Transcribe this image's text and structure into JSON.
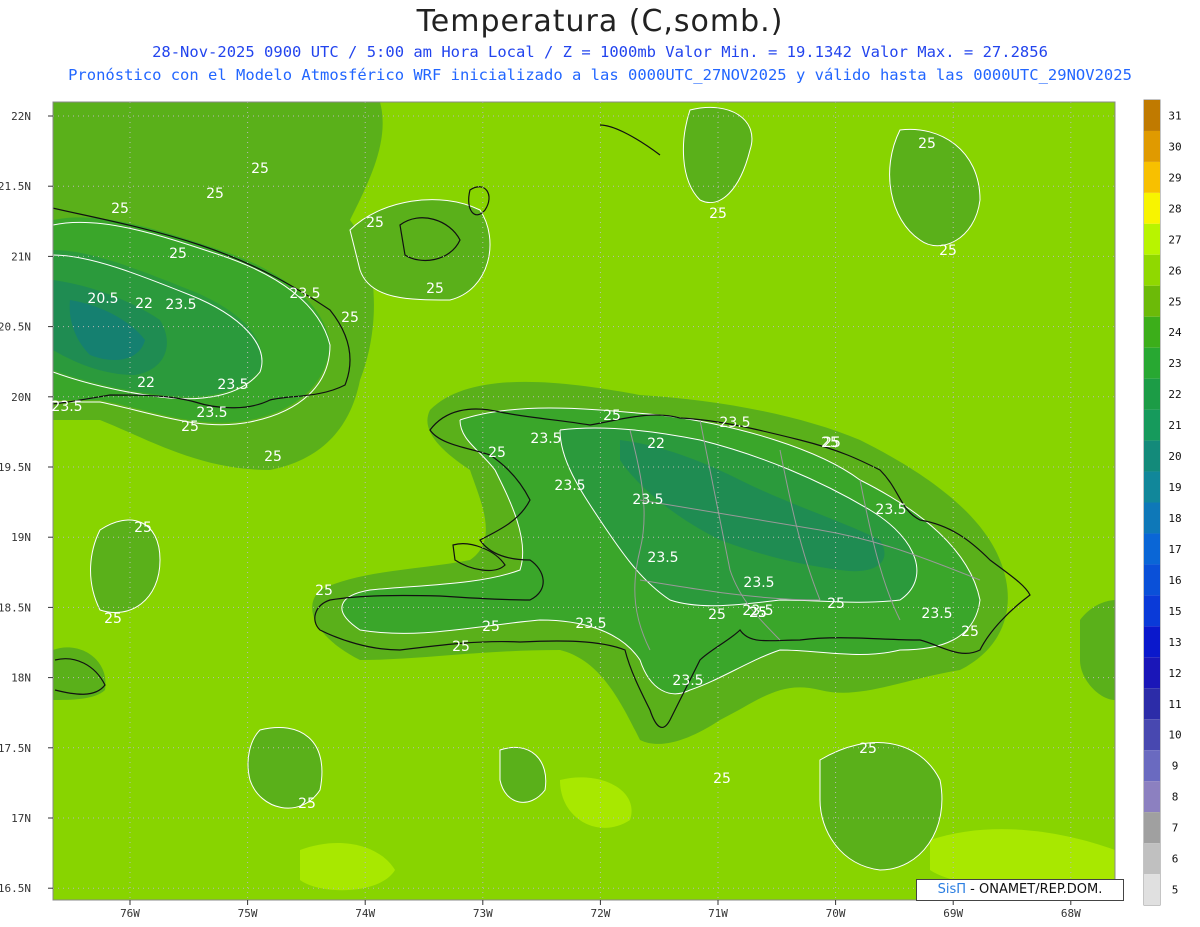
{
  "title": "Temperatura (C,somb.)",
  "subtitle_line1": "28-Nov-2025  0900 UTC / 5:00 am Hora Local / Z = 1000mb    Valor Min. = 19.1342  Valor Max. = 27.2856",
  "subtitle_line2": "Pronóstico con el Modelo Atmosférico WRF inicializado a las 0000UTC_27NOV2025 y válido hasta las  0000UTC_29NOV2025",
  "credit": {
    "brand": "SisΠ",
    "text": " - ONAMET/REP.DOM."
  },
  "lat_labels": [
    "22N",
    "21.5N",
    "21N",
    "20.5N",
    "20N",
    "19.5N",
    "19N",
    "18.5N",
    "18N",
    "17.5N",
    "17N",
    "16.5N"
  ],
  "lon_labels": [
    "76W",
    "75W",
    "74W",
    "73W",
    "72W",
    "71W",
    "70W",
    "69W",
    "68W"
  ],
  "colorbar": {
    "values": [
      "31",
      "30",
      "29",
      "28",
      "27",
      "26",
      "25",
      "24",
      "23",
      "22",
      "21",
      "20",
      "19",
      "18",
      "17",
      "16",
      "15",
      "13",
      "12",
      "11",
      "10",
      "9",
      "8",
      "7",
      "6",
      "5"
    ],
    "colors": [
      "#c07a00",
      "#e09a00",
      "#f8c000",
      "#f8f400",
      "#b8f400",
      "#90d800",
      "#6cba08",
      "#3cae1a",
      "#28a832",
      "#1c9c46",
      "#169a5c",
      "#138a7a",
      "#11879a",
      "#0e78b8",
      "#0a66d6",
      "#0a50d8",
      "#0a3ad8",
      "#0a18cc",
      "#1a16b8",
      "#2c2ca8",
      "#4848b0",
      "#6a6ac0",
      "#8c80c0",
      "#a0a0a0",
      "#c0c0c0",
      "#e0e0e0"
    ]
  },
  "contour_labels": [
    "25",
    "25",
    "25",
    "25",
    "25",
    "25",
    "25",
    "25",
    "25",
    "25",
    "20.5",
    "22",
    "23.5",
    "23.5",
    "25",
    "22",
    "23.5",
    "23.5",
    "23.5",
    "25",
    "25",
    "25",
    "23.5",
    "22",
    "23.5",
    "25",
    "25",
    "23.5",
    "23.5",
    "23.5",
    "23.5",
    "23.5",
    "25",
    "23.5",
    "23.5",
    "25",
    "25",
    "25",
    "25",
    "25",
    "25",
    "25",
    "25",
    "23.5",
    "25",
    "25",
    "25",
    "25",
    "25",
    "25",
    "23.5",
    "25",
    "25"
  ],
  "map_colors": {
    "ocean": "#88d400",
    "warm": "#a8e800",
    "band25": "#5ab01a",
    "band24": "#3aa62a",
    "band23": "#2b9a3c",
    "band22": "#1f8c52",
    "band21": "#158070",
    "coast": "#111111",
    "border": "#999999"
  }
}
